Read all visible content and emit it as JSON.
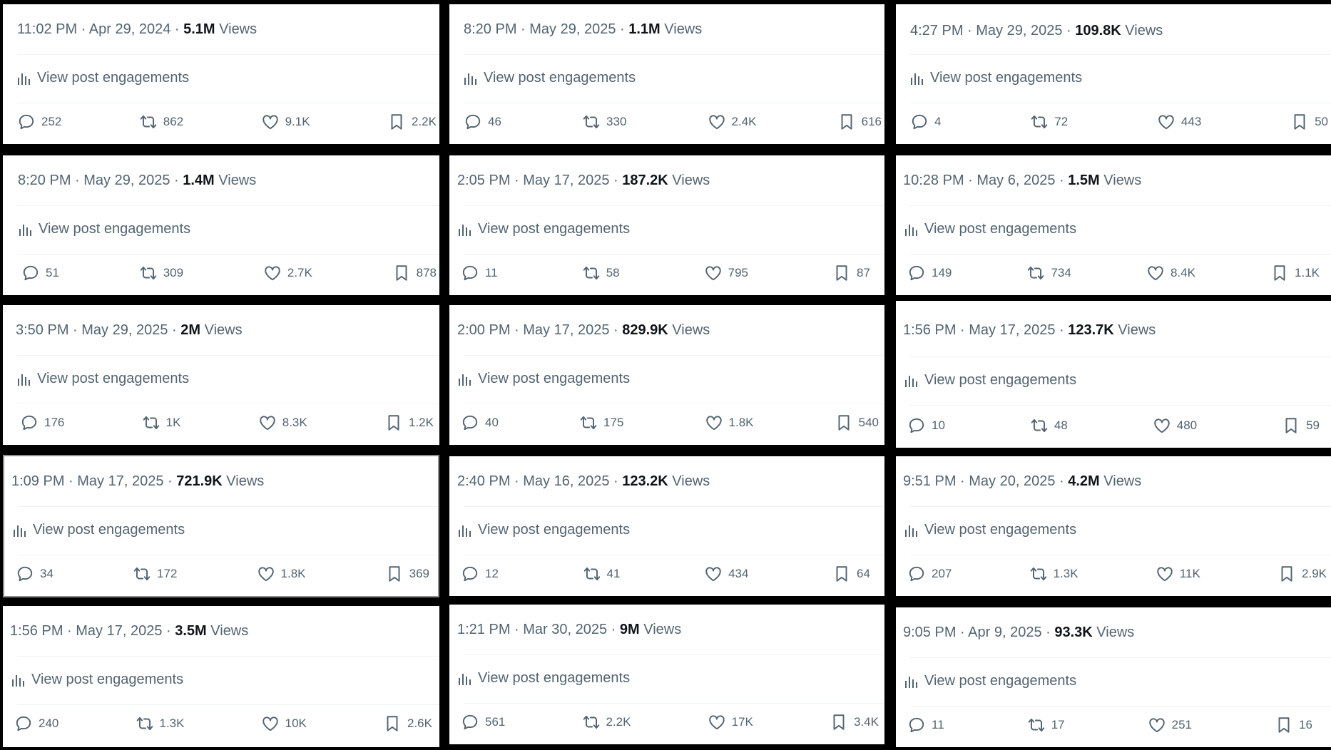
{
  "labels": {
    "views": "Views",
    "engagements": "View post engagements"
  },
  "icons": {
    "reply": "reply-icon",
    "repost": "repost-icon",
    "like": "like-icon",
    "bookmark": "bookmark-icon",
    "analytics": "analytics-icon"
  },
  "colors": {
    "background": "#000000",
    "card": "#ffffff",
    "text": "#536471",
    "strong": "#0f1419",
    "divider": "#eff3f4"
  },
  "posts": [
    {
      "time": "11:02 PM · Apr 29, 2024 · ",
      "views": "5.1M",
      "replies": "252",
      "reposts": "862",
      "likes": "9.1K",
      "bookmarks": "2.2K"
    },
    {
      "time": "8:20 PM · May 29, 2025 · ",
      "views": "1.1M",
      "replies": "46",
      "reposts": "330",
      "likes": "2.4K",
      "bookmarks": "616"
    },
    {
      "time": "4:27 PM · May 29, 2025 · ",
      "views": "109.8K",
      "replies": "4",
      "reposts": "72",
      "likes": "443",
      "bookmarks": "50"
    },
    {
      "time": "8:20 PM · May 29, 2025 · ",
      "views": "1.4M",
      "replies": "51",
      "reposts": "309",
      "likes": "2.7K",
      "bookmarks": "878"
    },
    {
      "time": "2:05 PM · May 17, 2025 · ",
      "views": "187.2K",
      "replies": "11",
      "reposts": "58",
      "likes": "795",
      "bookmarks": "87"
    },
    {
      "time": "10:28 PM · May 6, 2025 · ",
      "views": "1.5M",
      "replies": "149",
      "reposts": "734",
      "likes": "8.4K",
      "bookmarks": "1.1K"
    },
    {
      "time": "3:50 PM · May 29, 2025 · ",
      "views": "2M",
      "replies": "176",
      "reposts": "1K",
      "likes": "8.3K",
      "bookmarks": "1.2K"
    },
    {
      "time": "2:00 PM · May 17, 2025 · ",
      "views": "829.9K",
      "replies": "40",
      "reposts": "175",
      "likes": "1.8K",
      "bookmarks": "540"
    },
    {
      "time": "1:56 PM · May 17, 2025 · ",
      "views": "123.7K",
      "replies": "10",
      "reposts": "48",
      "likes": "480",
      "bookmarks": "59"
    },
    {
      "time": "1:09 PM · May 17, 2025 · ",
      "views": "721.9K",
      "replies": "34",
      "reposts": "172",
      "likes": "1.8K",
      "bookmarks": "369"
    },
    {
      "time": "2:40 PM · May 16, 2025 · ",
      "views": "123.2K",
      "replies": "12",
      "reposts": "41",
      "likes": "434",
      "bookmarks": "64"
    },
    {
      "time": "9:51 PM · May 20, 2025 · ",
      "views": "4.2M",
      "replies": "207",
      "reposts": "1.3K",
      "likes": "11K",
      "bookmarks": "2.9K"
    },
    {
      "time": "1:56 PM · May 17, 2025 · ",
      "views": "3.5M",
      "replies": "240",
      "reposts": "1.3K",
      "likes": "10K",
      "bookmarks": "2.6K"
    },
    {
      "time": "1:21 PM · Mar 30, 2025 · ",
      "views": "9M",
      "replies": "561",
      "reposts": "2.2K",
      "likes": "17K",
      "bookmarks": "3.4K"
    },
    {
      "time": "9:05 PM · Apr 9, 2025 · ",
      "views": "93.3K",
      "replies": "11",
      "reposts": "17",
      "likes": "251",
      "bookmarks": "16"
    }
  ]
}
